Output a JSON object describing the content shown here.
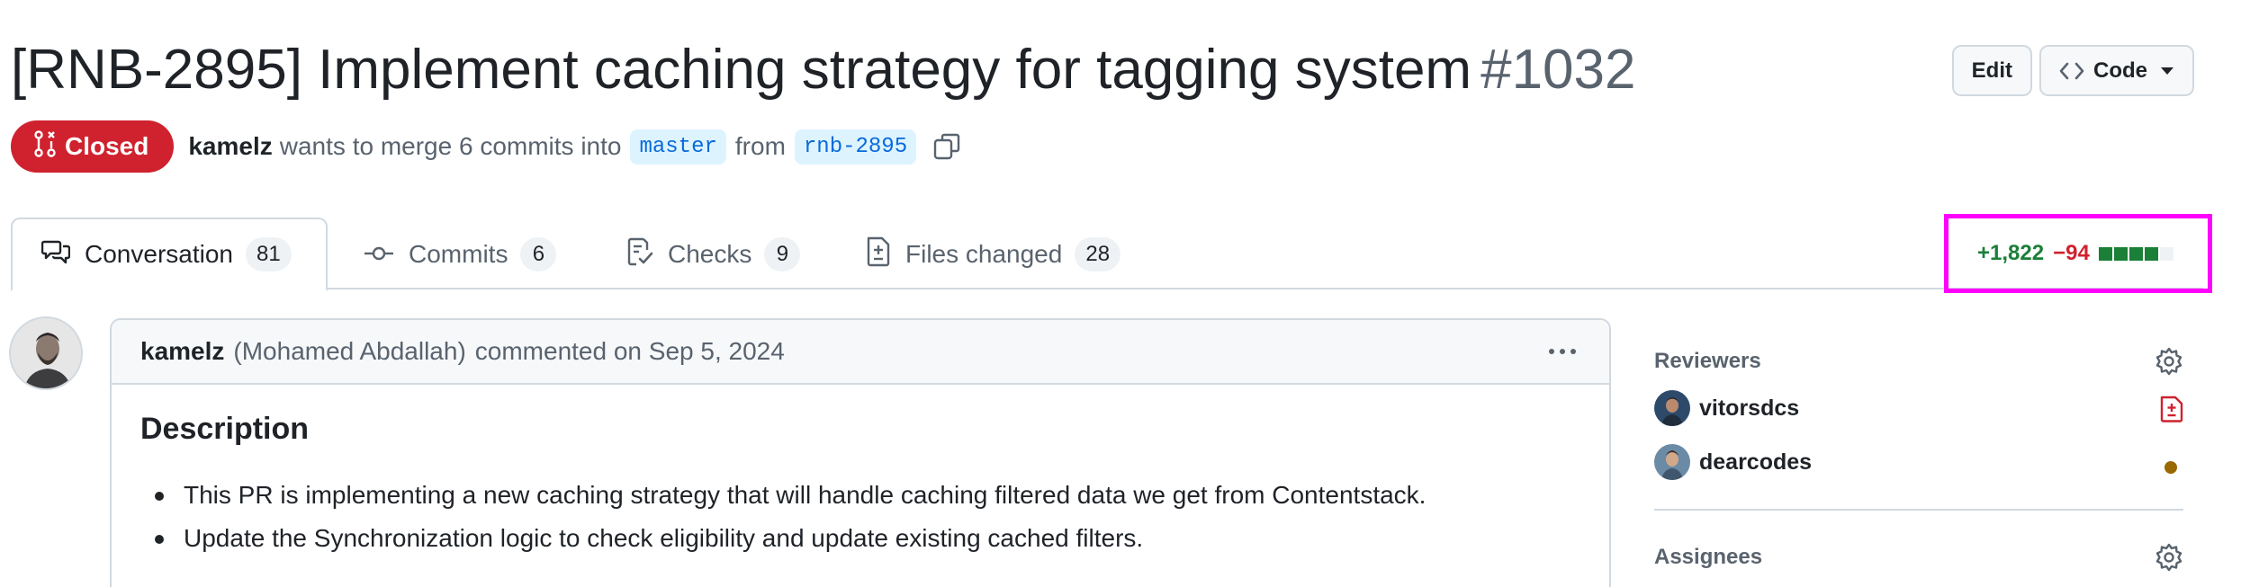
{
  "pr": {
    "title": "[RNB-2895] Implement caching strategy for tagging system",
    "number": "#1032",
    "state": "Closed",
    "author": "kamelz",
    "merge_text": "wants to merge 6 commits into",
    "base_branch": "master",
    "from_text": "from",
    "head_branch": "rnb-2895"
  },
  "header": {
    "edit_label": "Edit",
    "code_label": "Code"
  },
  "tabs": [
    {
      "label": "Conversation",
      "count": "81",
      "icon": "comment-discussion-icon"
    },
    {
      "label": "Commits",
      "count": "6",
      "icon": "git-commit-icon"
    },
    {
      "label": "Checks",
      "count": "9",
      "icon": "checklist-icon"
    },
    {
      "label": "Files changed",
      "count": "28",
      "icon": "file-diff-icon"
    }
  ],
  "diffstat": {
    "additions": "+1,822",
    "deletions": "−94",
    "blocks": [
      "added",
      "added",
      "added",
      "added",
      "neutral"
    ]
  },
  "comment": {
    "author": "kamelz",
    "full_name": "(Mohamed Abdallah)",
    "action": "commented on Sep 5, 2024",
    "heading": "Description",
    "bullets": [
      "This PR is implementing a new caching strategy that will handle caching filtered data we get from Contentstack.",
      "Update the Synchronization logic to check eligibility and update existing cached filters."
    ]
  },
  "sidebar": {
    "reviewers_label": "Reviewers",
    "reviewers": [
      {
        "name": "vitorsdcs",
        "status": "changes-requested"
      },
      {
        "name": "dearcodes",
        "status": "pending"
      }
    ],
    "assignees_label": "Assignees"
  },
  "colors": {
    "closed": "#cf222e",
    "additions": "#1a7f37",
    "deletions": "#cf222e",
    "link": "#0969da",
    "pending": "#9a6700",
    "highlight_box": "#ff00ff"
  }
}
